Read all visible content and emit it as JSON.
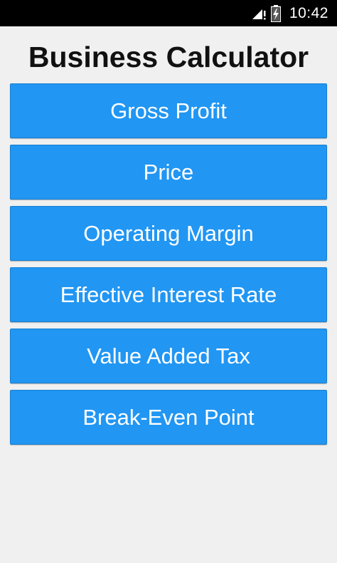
{
  "status_bar": {
    "time": "10:42",
    "icons": [
      "signal-icon",
      "battery-charging-icon"
    ]
  },
  "title": "Business Calculator",
  "colors": {
    "button_background": "#2196f3",
    "button_text": "#ffffff",
    "page_background": "#f0f0f0",
    "status_bar": "#000000"
  },
  "menu": {
    "items": [
      {
        "label": "Gross Profit"
      },
      {
        "label": "Price"
      },
      {
        "label": "Operating Margin"
      },
      {
        "label": "Effective Interest Rate"
      },
      {
        "label": "Value Added Tax"
      },
      {
        "label": "Break-Even Point"
      }
    ]
  }
}
